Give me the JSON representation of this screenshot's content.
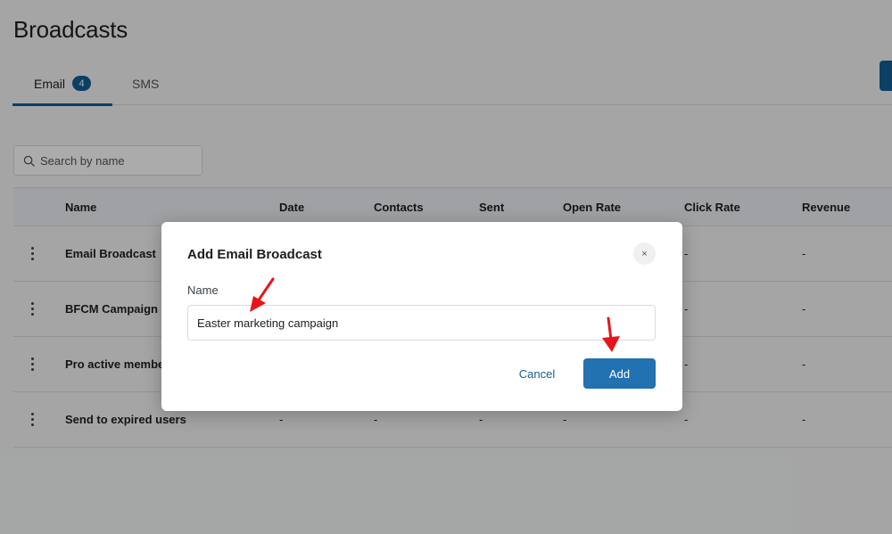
{
  "page": {
    "title": "Broadcasts"
  },
  "tabs": [
    {
      "label": "Email",
      "badge": "4",
      "active": true
    },
    {
      "label": "SMS",
      "active": false
    }
  ],
  "search": {
    "placeholder": "Search by name",
    "icon": "search-icon"
  },
  "table": {
    "columns": [
      "Name",
      "Date",
      "Contacts",
      "Sent",
      "Open Rate",
      "Click Rate",
      "Revenue"
    ],
    "rows": [
      {
        "name": "Email Broadcast",
        "date": "-",
        "contacts": "-",
        "sent": "-",
        "open_rate": "-",
        "click_rate": "-",
        "revenue": "-"
      },
      {
        "name": "BFCM Campaign",
        "date": "-",
        "contacts": "-",
        "sent": "-",
        "open_rate": "-",
        "click_rate": "-",
        "revenue": "-"
      },
      {
        "name": "Pro active members",
        "date": "-",
        "contacts": "-",
        "sent": "-",
        "open_rate": "-",
        "click_rate": "-",
        "revenue": "-"
      },
      {
        "name": "Send to expired users",
        "date": "-",
        "contacts": "-",
        "sent": "-",
        "open_rate": "-",
        "click_rate": "-",
        "revenue": "-"
      }
    ]
  },
  "modal": {
    "title": "Add Email Broadcast",
    "close_icon": "×",
    "field_label": "Name",
    "field_value": "Easter marketing campaign",
    "cancel_label": "Cancel",
    "add_label": "Add"
  },
  "annotations": {
    "arrow_color": "#e8141b"
  },
  "colors": {
    "accent": "#135e96",
    "button": "#2271b1"
  }
}
